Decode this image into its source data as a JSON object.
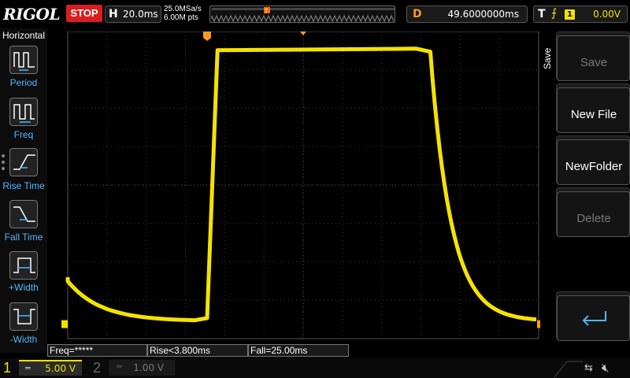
{
  "topbar": {
    "logo": "RIGOL",
    "run_state": "STOP",
    "horizontal": {
      "letter": "H",
      "timebase": "20.0ms"
    },
    "sample_rate": "25.0MSa/s",
    "memory_depth": "6.00M pts",
    "delay": {
      "letter": "D",
      "value": "49.6000000ms"
    },
    "trigger": {
      "letter": "T",
      "edge_icon": "rising-edge-icon",
      "source": "1",
      "level": "0.00V"
    }
  },
  "left_panel": {
    "title": "Horizontal",
    "items": [
      {
        "label": "Period",
        "icon": "period-icon"
      },
      {
        "label": "Freq",
        "icon": "freq-icon"
      },
      {
        "label": "Rise Time",
        "icon": "rise-time-icon"
      },
      {
        "label": "Fall Time",
        "icon": "fall-time-icon"
      },
      {
        "label": "+Width",
        "icon": "pos-width-icon"
      },
      {
        "label": "-Width",
        "icon": "neg-width-icon"
      }
    ]
  },
  "right_panel": {
    "tab": "Save",
    "buttons": [
      {
        "label": "Save",
        "enabled": false
      },
      {
        "label": "New File",
        "enabled": true
      },
      {
        "label": "NewFolder",
        "enabled": true
      },
      {
        "label": "Delete",
        "enabled": false
      },
      {
        "label": "",
        "icon": "enter-return-icon",
        "enabled": true
      }
    ]
  },
  "measurements": {
    "freq": "Freq=*****",
    "rise": "Rise<3.800ms",
    "fall": "Fall=25.00ms"
  },
  "channels": [
    {
      "number": "1",
      "coupling": "═",
      "scale": "5.00 V",
      "active": true
    },
    {
      "number": "2",
      "coupling": "═",
      "scale": "1.00 V",
      "active": false
    }
  ],
  "colors": {
    "ch1": "#f5e200",
    "trigger_marker": "#ff9b1a",
    "stop": "#d81e1e",
    "measure_label": "#4fb7ff"
  }
}
